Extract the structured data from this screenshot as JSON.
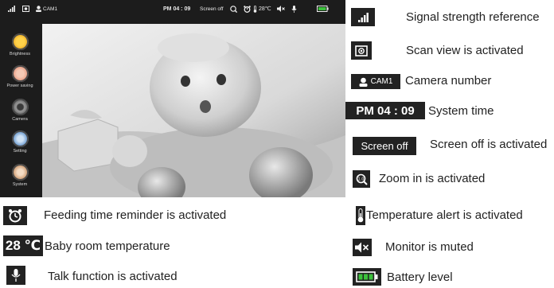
{
  "status_bar": {
    "camera_label": "CAM1",
    "time": "PM 04 : 09",
    "screen_off": "Screen off",
    "temperature": "28℃"
  },
  "sidebar": {
    "items": [
      {
        "label": "Brightness",
        "icon": "brightness-icon",
        "color": "#f2b01e"
      },
      {
        "label": "Power saving",
        "icon": "power-saving-icon",
        "color": "#e8967a"
      },
      {
        "label": "Camera",
        "icon": "camera-icon",
        "color": "#7b7b7b"
      },
      {
        "label": "Setting",
        "icon": "setting-icon",
        "color": "#4f86c6"
      },
      {
        "label": "System",
        "icon": "system-icon",
        "color": "#c48a5a"
      }
    ]
  },
  "legend": {
    "signal": "Signal strength reference",
    "scan": "Scan view is activated",
    "camera_chip": "CAM1",
    "camera": "Camera number",
    "time_chip": "PM 04 : 09",
    "time": "System time",
    "screen_off_chip": "Screen off",
    "screen_off": "Screen off is activated",
    "zoom": "Zoom in is activated",
    "feeding": "Feeding time reminder is activated",
    "temp_value": "28 ℃",
    "temp": "Baby room temperature",
    "talk": "Talk function is activated",
    "temp_alert": "Temperature alert is activated",
    "muted": "Monitor is muted",
    "battery": "Battery level"
  },
  "colors": {
    "battery_green": "#3cc13c",
    "device_bg": "#1c1c1c",
    "chip_bg": "#222222"
  }
}
